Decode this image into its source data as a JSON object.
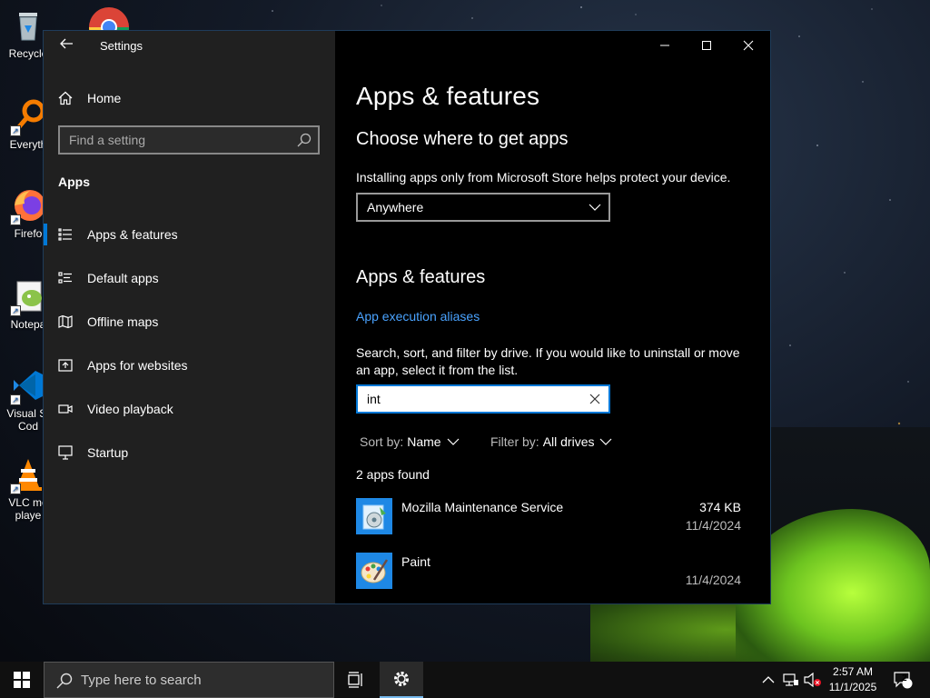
{
  "desktop": {
    "icons": [
      {
        "label": "Recycle",
        "name": "recycle-bin"
      },
      {
        "label": "Everyth",
        "name": "everything"
      },
      {
        "label": "Firefo",
        "name": "firefox"
      },
      {
        "label": "Notepa",
        "name": "notepad-plus-plus"
      },
      {
        "label": "Visual St",
        "label2": "Cod",
        "name": "visual-studio-code"
      },
      {
        "label": "VLC me",
        "label2": "playe",
        "name": "vlc-media-player"
      }
    ]
  },
  "window": {
    "title": "Settings",
    "nav": {
      "home_label": "Home",
      "search_placeholder": "Find a setting",
      "section_label": "Apps",
      "items": [
        {
          "label": "Apps & features",
          "icon": "apps-features-icon",
          "active": true
        },
        {
          "label": "Default apps",
          "icon": "default-apps-icon"
        },
        {
          "label": "Offline maps",
          "icon": "offline-maps-icon"
        },
        {
          "label": "Apps for websites",
          "icon": "apps-for-websites-icon"
        },
        {
          "label": "Video playback",
          "icon": "video-playback-icon"
        },
        {
          "label": "Startup",
          "icon": "startup-icon"
        }
      ]
    },
    "content": {
      "page_title": "Apps & features",
      "choose_heading": "Choose where to get apps",
      "choose_description": "Installing apps only from Microsoft Store helps protect your device.",
      "source_dropdown_value": "Anywhere",
      "section_heading": "Apps & features",
      "aliases_link": "App execution aliases",
      "search_description": "Search, sort, and filter by drive. If you would like to uninstall or move an app, select it from the list.",
      "search_value": "int",
      "sort_label": "Sort by:",
      "sort_value": "Name",
      "filter_label": "Filter by:",
      "filter_value": "All drives",
      "results_count": "2 apps found",
      "apps": [
        {
          "name": "Mozilla Maintenance Service",
          "size": "374 KB",
          "date": "11/4/2024"
        },
        {
          "name": "Paint",
          "size": "",
          "date": "11/4/2024"
        }
      ]
    }
  },
  "taskbar": {
    "search_placeholder": "Type here to search",
    "clock_time": "2:57 AM",
    "clock_date": "11/1/2025",
    "notification_count": "2"
  },
  "colors": {
    "accent": "#0078d7",
    "link": "#4aa3ff",
    "nav_bg": "#202020",
    "content_bg": "#000000"
  }
}
